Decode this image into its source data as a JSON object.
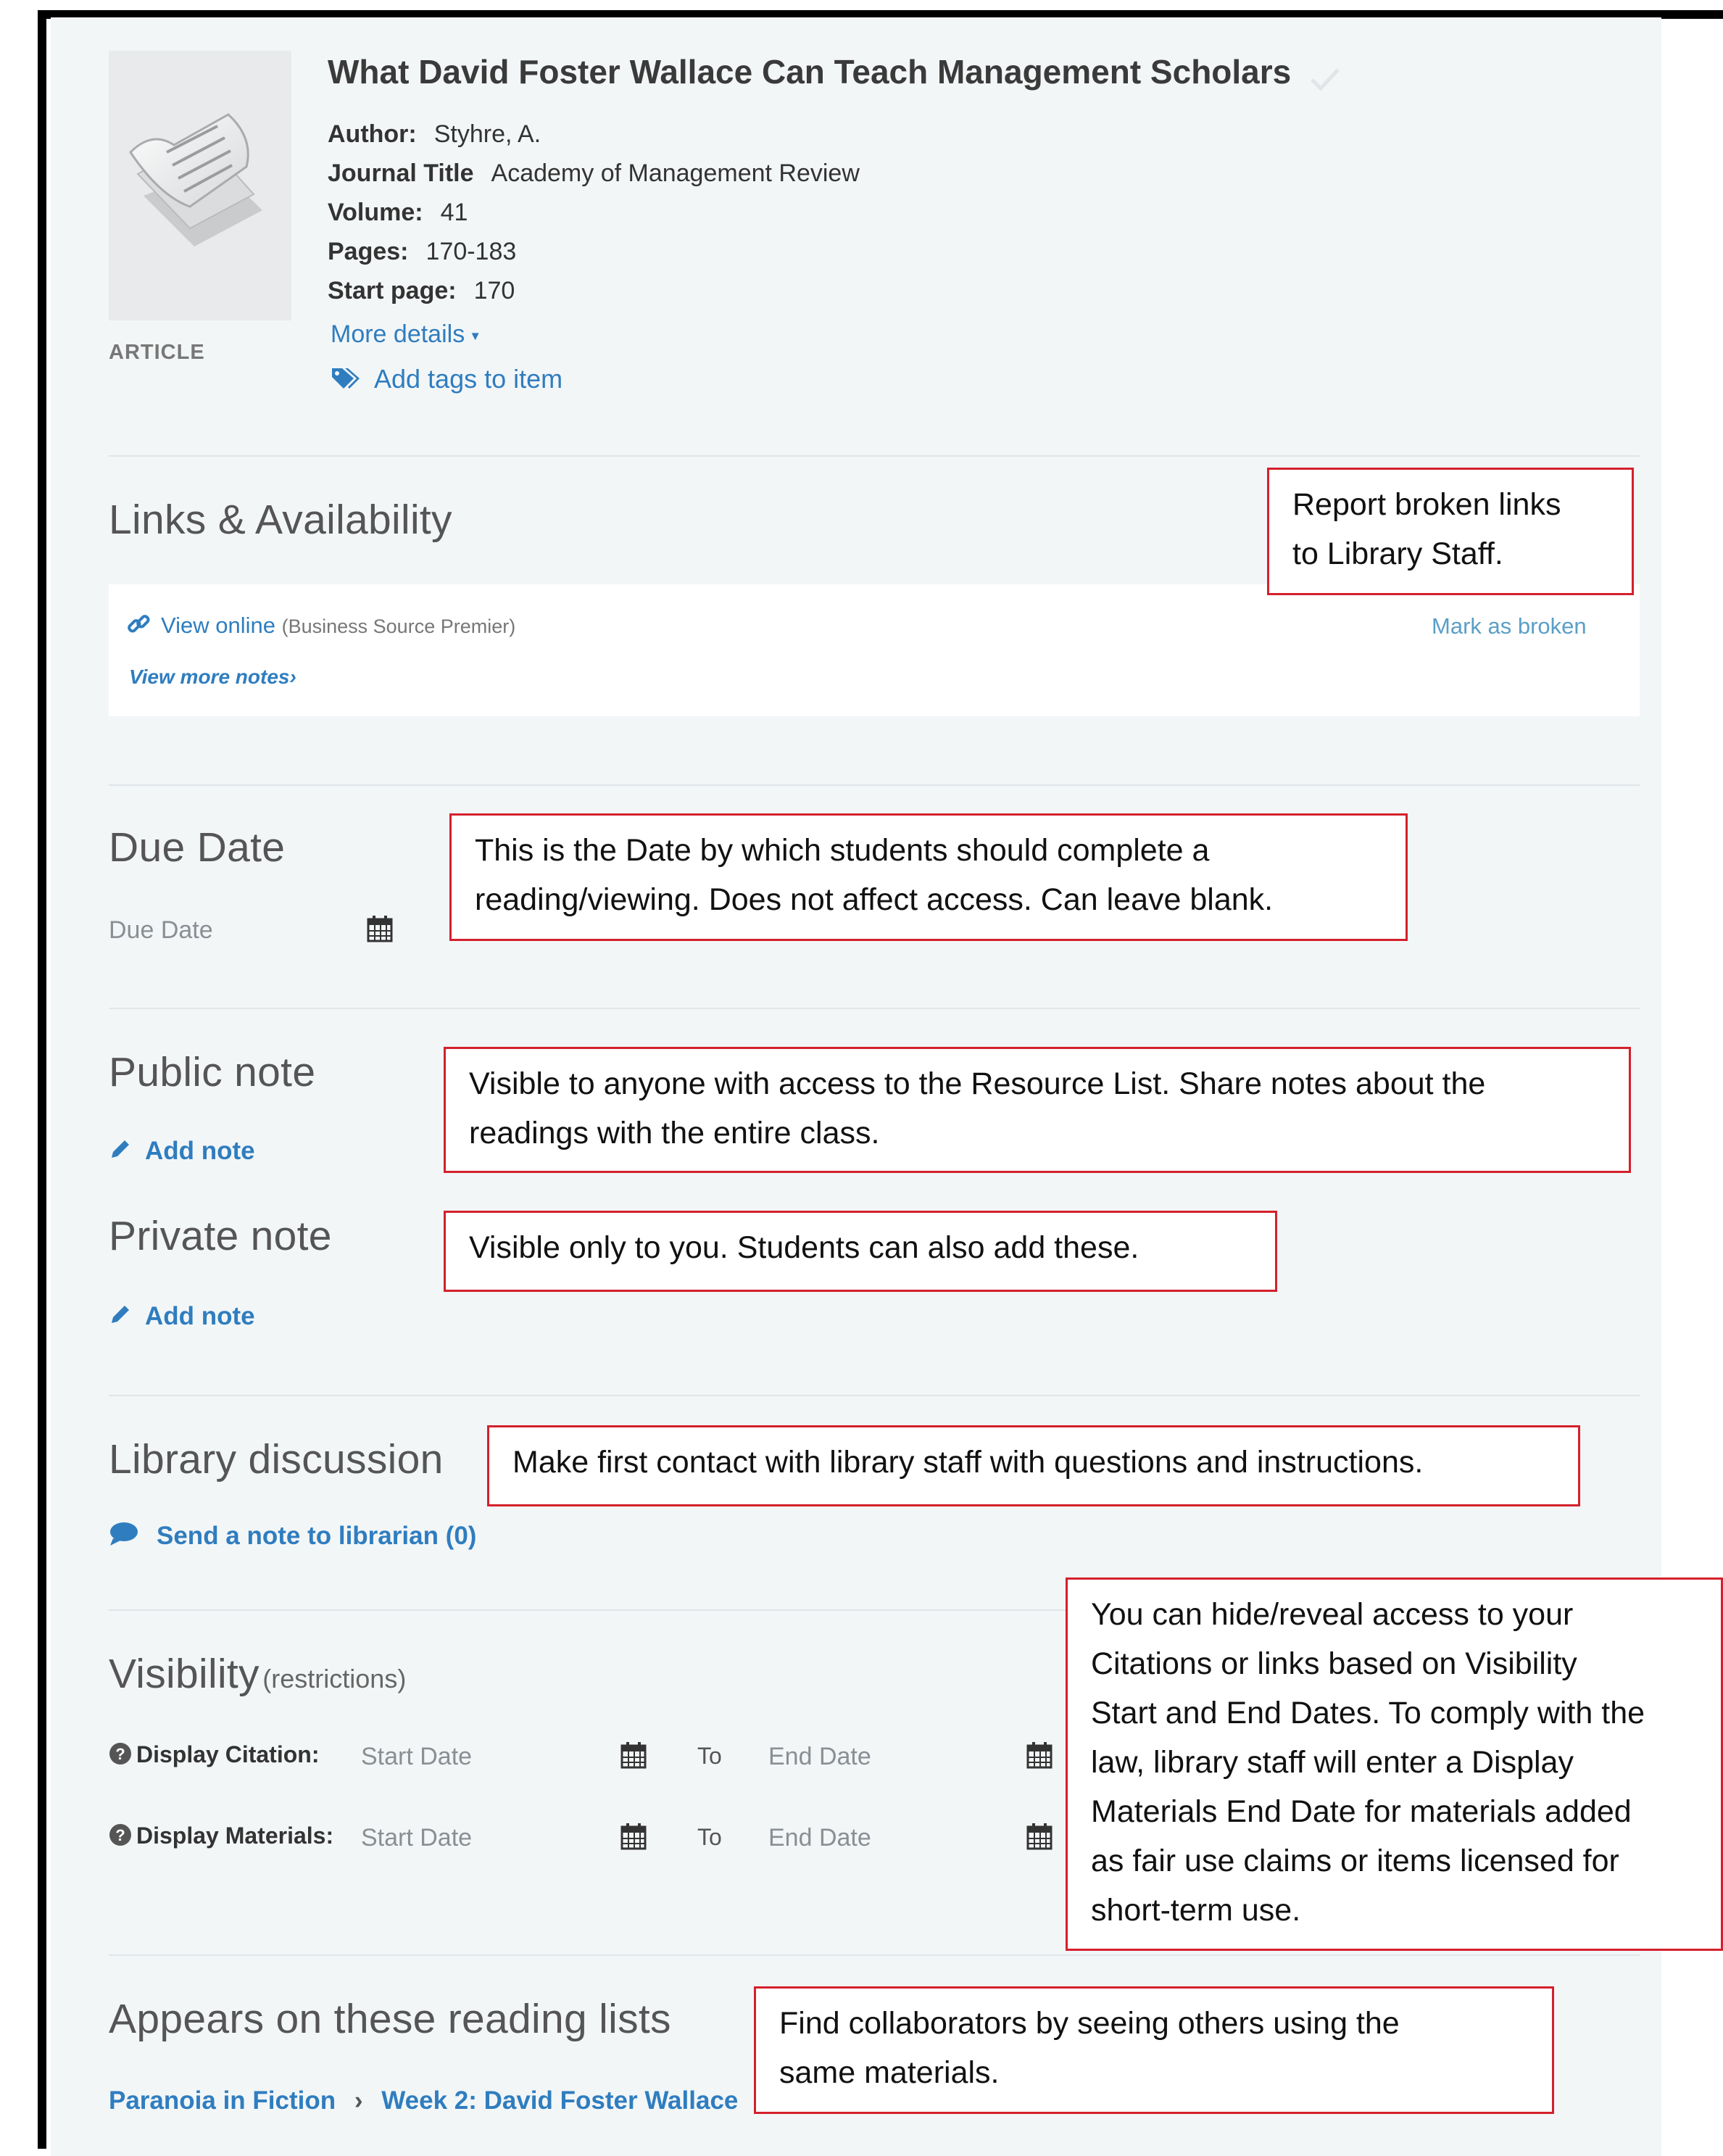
{
  "item": {
    "title": "What David Foster Wallace Can Teach Management Scholars",
    "type_label": "ARTICLE",
    "author_key": "Author:",
    "author": "Styhre, A.",
    "journal_key": "Journal Title",
    "journal": "Academy of Management Review",
    "volume_key": "Volume:",
    "volume": "41",
    "pages_key": "Pages:",
    "pages": "170-183",
    "start_key": "Start page:",
    "start": "170",
    "more_details": "More details",
    "add_tags": "Add tags to item"
  },
  "links": {
    "heading": "Links & Availability",
    "view_online": "View online",
    "source": "(Business Source Premier)",
    "view_more_notes": "View more notes",
    "mark_broken": "Mark as broken"
  },
  "due": {
    "heading": "Due Date",
    "placeholder": "Due Date"
  },
  "public_note": {
    "heading": "Public note",
    "add": "Add note"
  },
  "private_note": {
    "heading": "Private note",
    "add": "Add note"
  },
  "discussion": {
    "heading": "Library discussion",
    "send": "Send a note to librarian (0)"
  },
  "visibility": {
    "heading": "Visibility",
    "sub": "(restrictions)",
    "rows": [
      {
        "label": "Display Citation:",
        "start": "Start Date",
        "to": "To",
        "end": "End Date"
      },
      {
        "label": "Display Materials:",
        "start": "Start Date",
        "to": "To",
        "end": "End Date"
      }
    ]
  },
  "reading_lists": {
    "heading": "Appears on these reading lists",
    "list": "Paranoia in Fiction",
    "section": "Week 2: David Foster Wallace"
  },
  "annotations": {
    "report_broken": [
      "Report broken links",
      "to Library Staff."
    ],
    "due_date": [
      "This is the Date by which students should complete a",
      "reading/viewing. Does not affect access. Can leave blank."
    ],
    "public": [
      "Visible to anyone with access to the Resource List. Share notes about the",
      "readings with the entire class."
    ],
    "private": [
      "Visible only to you. Students can also add these."
    ],
    "discussion": [
      "Make first contact with library staff with questions and instructions."
    ],
    "visibility": [
      "You can hide/reveal access to your",
      "Citations or links based on Visibility",
      "Start and End Dates. To comply with the",
      "law, library staff will enter a Display",
      "Materials End Date for materials added",
      "as fair use claims or items licensed for",
      "short-term use."
    ],
    "collab": [
      "Find collaborators by seeing others using the",
      "same materials."
    ]
  },
  "colors": {
    "link": "#2f7dbf",
    "annotation_border": "#d4202c",
    "panel": "#f3f6f7"
  }
}
